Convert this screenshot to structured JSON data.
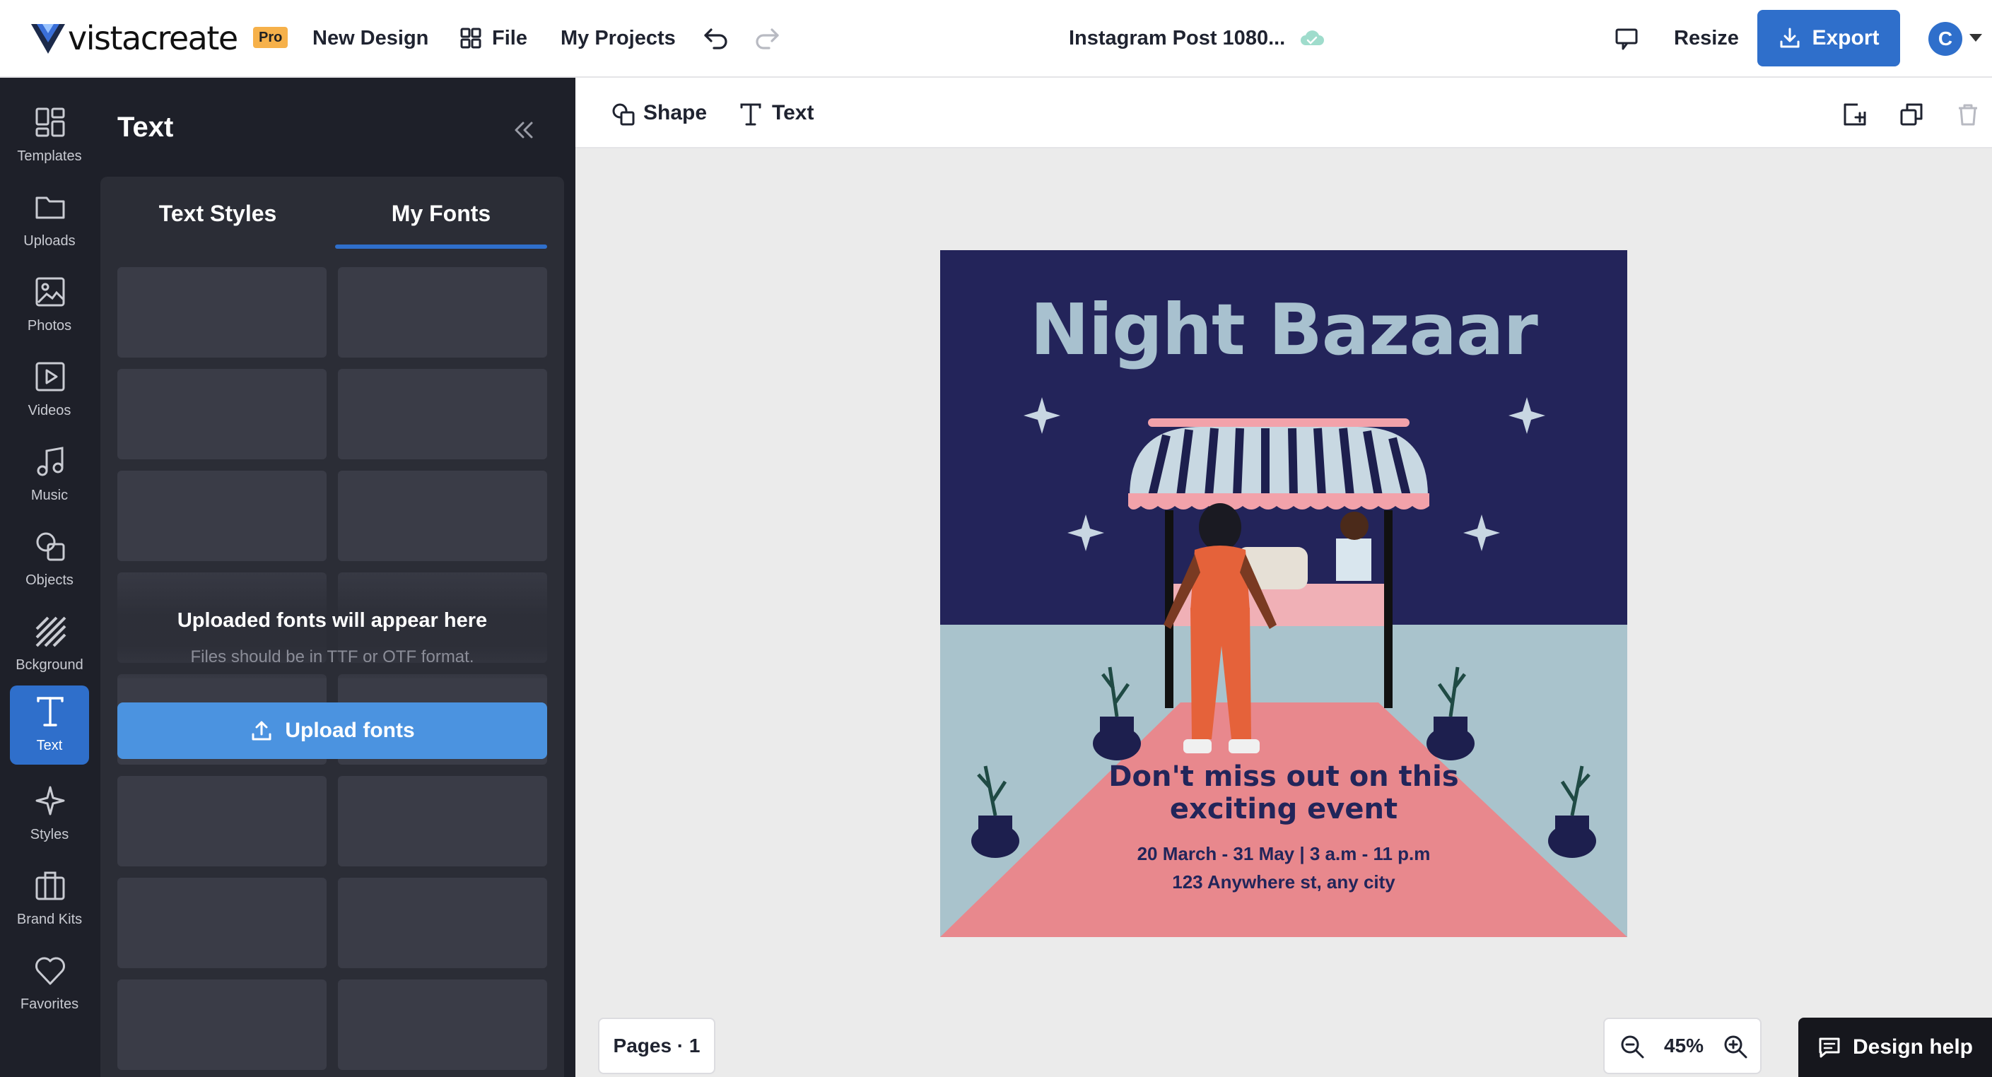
{
  "header": {
    "logo_text": "vistacreate",
    "pro_badge": "Pro",
    "new_design": "New Design",
    "file": "File",
    "my_projects": "My Projects",
    "doc_title": "Instagram Post 1080...",
    "resize": "Resize",
    "export": "Export",
    "avatar_initial": "C"
  },
  "rail": {
    "items": [
      {
        "label": "Templates",
        "icon": "templates-icon"
      },
      {
        "label": "Uploads",
        "icon": "folder-icon"
      },
      {
        "label": "Photos",
        "icon": "image-icon"
      },
      {
        "label": "Videos",
        "icon": "play-icon"
      },
      {
        "label": "Music",
        "icon": "music-icon"
      },
      {
        "label": "Objects",
        "icon": "shapes-icon"
      },
      {
        "label": "Bckground",
        "icon": "background-icon"
      },
      {
        "label": "Text",
        "icon": "text-icon",
        "active": true
      },
      {
        "label": "Styles",
        "icon": "sparkle-icon"
      },
      {
        "label": "Brand Kits",
        "icon": "briefcase-icon"
      },
      {
        "label": "Favorites",
        "icon": "heart-icon"
      }
    ]
  },
  "panel": {
    "title": "Text",
    "tabs": [
      {
        "label": "Text Styles",
        "active": false
      },
      {
        "label": "My Fonts",
        "active": true
      }
    ],
    "empty_title": "Uploaded fonts will appear here",
    "empty_subtitle": "Files should be in TTF or OTF format.",
    "upload_button": "Upload fonts"
  },
  "toolbar": {
    "shape": "Shape",
    "text": "Text"
  },
  "canvas": {
    "title": "Night Bazaar",
    "headline": "Don't miss out on this exciting event",
    "headline_line1": "Don't miss out on this",
    "headline_line2": "exciting event",
    "details_line1": "20 March - 31 May | 3 a.m - 11 p.m",
    "details_line2": "123 Anywhere st, any city",
    "colors": {
      "sky": "#23245a",
      "ground": "#a9c3cc",
      "carpet": "#e8888d",
      "title": "#a8c1cf",
      "text": "#22255a"
    }
  },
  "footer": {
    "pages": "Pages · 1",
    "zoom": "45%",
    "design_help": "Design help"
  },
  "colors": {
    "accent": "#2f6fcb",
    "panel_bg": "#1e2029",
    "upload_btn": "#4b93e0"
  }
}
